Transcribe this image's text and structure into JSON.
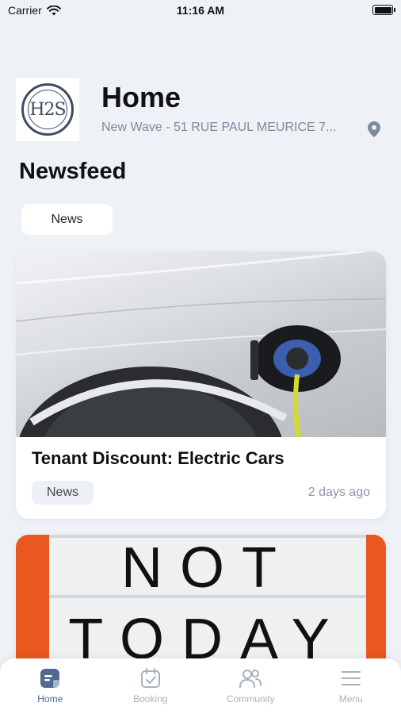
{
  "status_bar": {
    "carrier": "Carrier",
    "time": "11:16 AM"
  },
  "header": {
    "logo_text": "H2S",
    "title": "Home",
    "location": "New Wave - 51 RUE PAUL MEURICE 7..."
  },
  "newsfeed": {
    "title": "Newsfeed",
    "filter_chip": "News"
  },
  "cards": [
    {
      "title": "Tenant Discount: Electric Cars",
      "tag": "News",
      "date": "2 days ago"
    },
    {
      "image_words": [
        "NOT",
        "TODAY"
      ]
    }
  ],
  "tab_bar": {
    "items": [
      {
        "label": "Home",
        "icon": "home-icon",
        "active": true
      },
      {
        "label": "Booking",
        "icon": "calendar-check-icon",
        "active": false
      },
      {
        "label": "Community",
        "icon": "people-icon",
        "active": false
      },
      {
        "label": "Menu",
        "icon": "menu-icon",
        "active": false
      }
    ]
  },
  "colors": {
    "background": "#eef2f7",
    "accent": "#4e6a90",
    "muted": "#a7b0bb",
    "card2_bg": "#e8581f"
  }
}
